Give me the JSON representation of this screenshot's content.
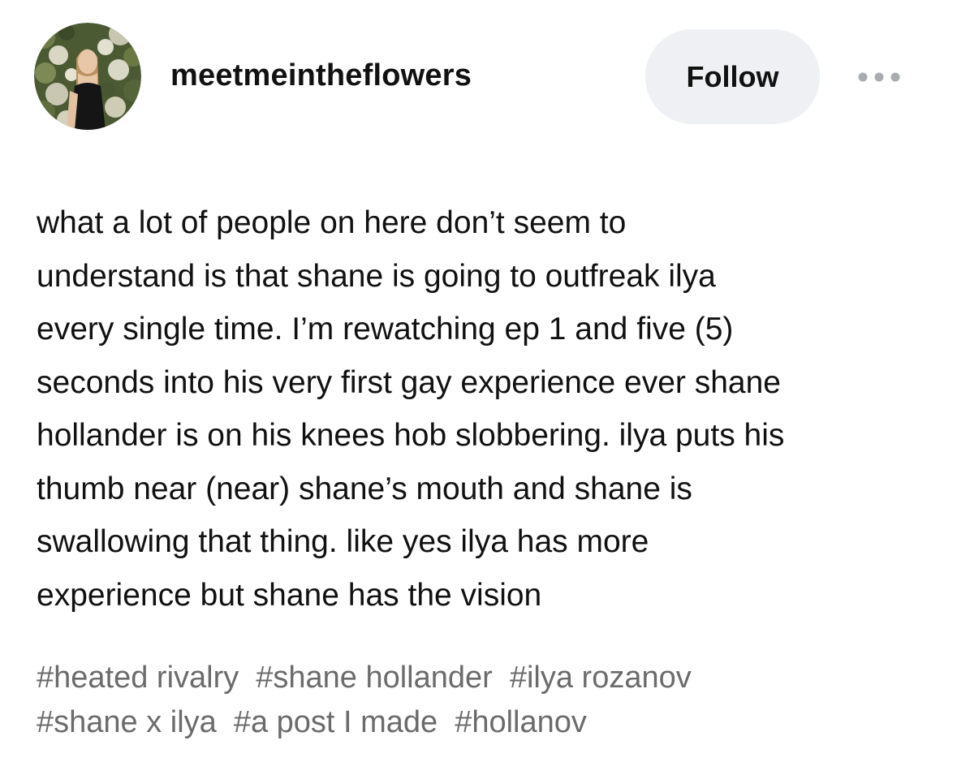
{
  "post": {
    "username": "meetmeintheflowers",
    "follow_label": "Follow",
    "more_icon": "ellipsis-icon",
    "avatar_icon": "avatar-photo",
    "body_lines": [
      "what a lot of people on here don’t seem to",
      "understand is that shane is going to outfreak ilya",
      "every single time. I’m rewatching ep 1 and five (5)",
      "seconds into his very first gay experience ever shane",
      "hollander is on his knees hob slobbering. ilya puts his",
      "thumb near (near) shane’s mouth and shane is",
      "swallowing that thing. like yes ilya has more",
      "experience but shane has the vision"
    ],
    "tags": [
      "#heated rivalry",
      "#shane hollander",
      "#ilya rozanov",
      "#shane x ilya",
      "#a post I made",
      "#hollanov"
    ]
  },
  "colors": {
    "text": "#111111",
    "tag_text": "#6b6b6b",
    "follow_bg": "#eef0f3",
    "background": "#ffffff"
  }
}
